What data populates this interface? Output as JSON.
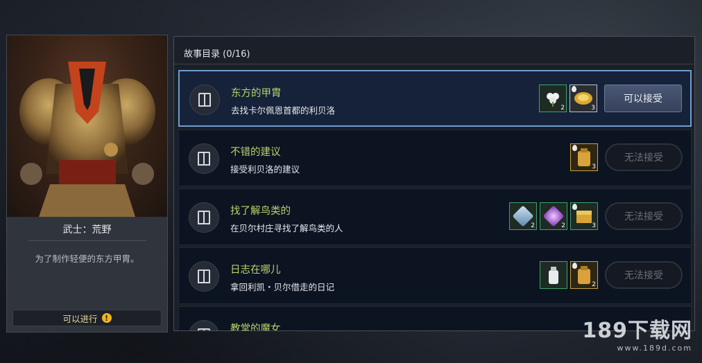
{
  "npc": {
    "name": "武士：荒野",
    "description": "为了制作轻便的东方甲胄。",
    "status_label": "可以进行",
    "status_icon": "exclamation-icon"
  },
  "panel": {
    "title": "故事目录 (0/16)"
  },
  "quests": [
    {
      "title": "东方的甲胄",
      "description": "去找卡尔佩恩首都的利贝洛",
      "button": "可以接受",
      "button_state": "active",
      "selected": true,
      "rewards": [
        {
          "icon": "cotton-flower-icon",
          "count": "2",
          "frame": "green"
        },
        {
          "icon": "gold-coin-icon",
          "count": "3",
          "frame": "white"
        }
      ]
    },
    {
      "title": "不错的建议",
      "description": "接受利贝洛的建议",
      "button": "无法接受",
      "button_state": "disabled",
      "selected": false,
      "rewards": [
        {
          "icon": "gold-bag-icon",
          "count": "3",
          "frame": "gold"
        }
      ]
    },
    {
      "title": "找了解鸟类的",
      "description": "在贝尔村庄寻找了解鸟类的人",
      "button": "无法接受",
      "button_state": "disabled",
      "selected": false,
      "rewards": [
        {
          "icon": "crystal-shard-icon",
          "count": "2",
          "frame": "green"
        },
        {
          "icon": "purple-gem-icon",
          "count": "2",
          "frame": "green"
        },
        {
          "icon": "gold-chest-icon",
          "count": "3",
          "frame": "green"
        }
      ]
    },
    {
      "title": "日志在哪儿",
      "description": "拿回利凯・贝尔借走的日记",
      "button": "无法接受",
      "button_state": "disabled",
      "selected": false,
      "rewards": [
        {
          "icon": "milk-can-icon",
          "count": "",
          "frame": "green"
        },
        {
          "icon": "gold-bag-icon",
          "count": "2",
          "frame": "gold"
        }
      ]
    },
    {
      "title": "教堂的魔女",
      "description": "",
      "button": "",
      "button_state": "disabled",
      "selected": false,
      "rewards": []
    }
  ],
  "watermark": {
    "main": "189下载网",
    "sub": "www.189d.com"
  },
  "colors": {
    "quest_title": "#b7d36a",
    "selected_border": "#6f9fcf",
    "status_text": "#e2d9a0"
  }
}
